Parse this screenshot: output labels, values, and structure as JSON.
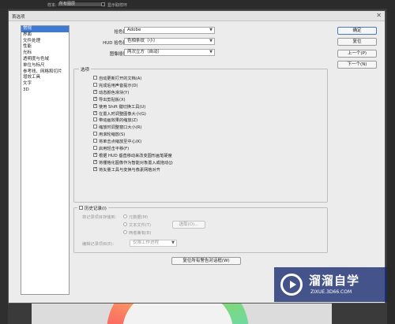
{
  "ps_toolbar": {
    "sample_label": "样本:",
    "sample_value": "所有图层",
    "show_ring_label": "显示取样环"
  },
  "dialog": {
    "title": "首选项",
    "close_glyph": "✕"
  },
  "categories": [
    "常规",
    "界面",
    "文件处理",
    "性能",
    "光标",
    "透明度与色域",
    "单位与标尺",
    "参考线、网格和切片",
    "增效工具",
    "文字",
    "3D"
  ],
  "selected_category": "常规",
  "fields": {
    "color_picker_label": "拾色器(C):",
    "color_picker_value": "Adobe",
    "hud_label": "HUD 拾色器(H):",
    "hud_value": "色相条纹（小）",
    "interp_label": "图像插值(N):",
    "interp_value": "两次立方（自动）"
  },
  "buttons": {
    "ok": "确定",
    "reset": "复位",
    "prev": "上一个(P)",
    "next": "下一个(N)",
    "reset_warnings": "复位所有警告对话框(W)"
  },
  "options": {
    "title": "选项",
    "items": [
      {
        "label": "自动更新打开的文档(A)",
        "checked": false
      },
      {
        "label": "完成后用声音提示(D)",
        "checked": false
      },
      {
        "label": "动态颜色滑块(Y)",
        "checked": true
      },
      {
        "label": "导出剪贴板(X)",
        "checked": true
      },
      {
        "label": "使用 Shift 键切换工具(U)",
        "checked": true
      },
      {
        "label": "在置入时调整图像大小(G)",
        "checked": true
      },
      {
        "label": "带动画效果的缩放(Z)",
        "checked": false
      },
      {
        "label": "缩放时调整窗口大小(R)",
        "checked": false
      },
      {
        "label": "用滚轮缩放(S)",
        "checked": false
      },
      {
        "label": "将单击点缩放至中心(K)",
        "checked": false
      },
      {
        "label": "启用轻击平移(F)",
        "checked": false
      },
      {
        "label": "根据 HUD 垂直移动来改变圆形画笔硬度",
        "checked": true
      },
      {
        "label": "将栅格化图像作为智能对象置入或拖动(J)",
        "checked": true
      },
      {
        "label": "将矢量工具与变换与像素网格对齐",
        "checked": true
      }
    ]
  },
  "history": {
    "title": "历史记录(I)",
    "checked": false,
    "save_to_label": "将记录项目存储到:",
    "radio_metadata": "元数据(M)",
    "radio_textfile": "文本文件(T)",
    "choose_button": "选取(O)...",
    "radio_both": "两者兼有(B)",
    "edit_log_label": "编辑记录项目(E):",
    "edit_log_value": "仅限工作进程"
  },
  "watermark": {
    "title": "溜溜自学",
    "url": "ZIXUE.3D66.COM"
  }
}
